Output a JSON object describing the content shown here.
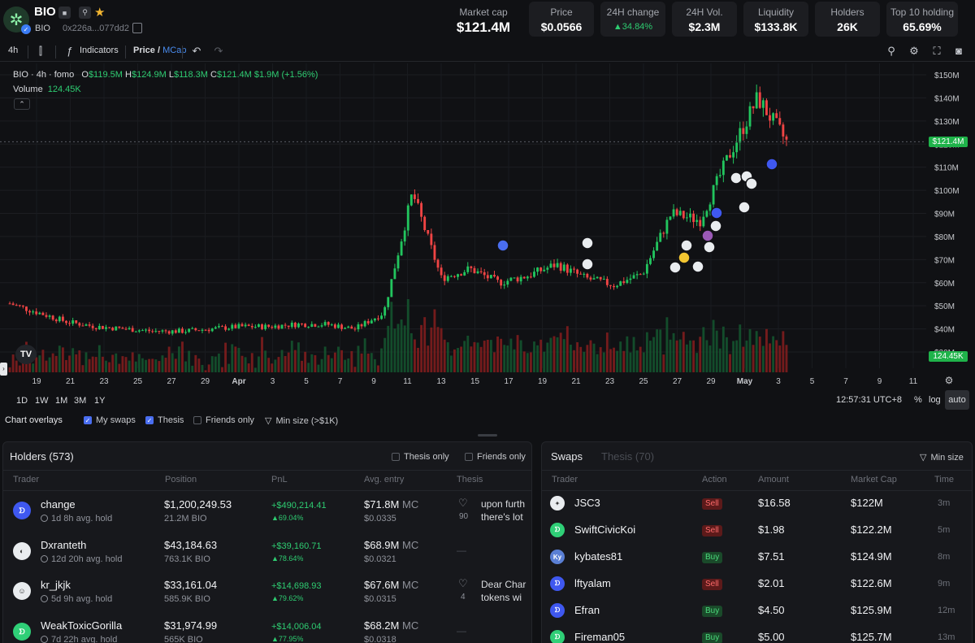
{
  "token": {
    "name": "BIO",
    "symbol": "BIO",
    "address": "0x226a...077dd2",
    "logo_icon": "sparkle-logo-icon"
  },
  "stats": {
    "market_cap": {
      "label": "Market cap",
      "value": "$121.4M"
    },
    "price": {
      "label": "Price",
      "value": "$0.0566"
    },
    "change": {
      "label": "24H change",
      "value": "▲34.84%"
    },
    "volume": {
      "label": "24H Vol.",
      "value": "$2.3M"
    },
    "liquidity": {
      "label": "Liquidity",
      "value": "$133.8K"
    },
    "holders": {
      "label": "Holders",
      "value": "26K"
    },
    "top10": {
      "label": "Top 10 holding",
      "value": "65.69%"
    }
  },
  "toolbar": {
    "interval": "4h",
    "indicators": "Indicators",
    "price_label": "Price",
    "mcap_label": "MCap"
  },
  "chart_legend": {
    "title": "BIO · 4h · fomo",
    "o_key": "O",
    "o": "$119.5M",
    "h_key": "H",
    "h": "$124.9M",
    "l_key": "L",
    "l": "$118.3M",
    "c_key": "C",
    "c": "$121.4M",
    "change": "$1.9M (+1.56%)",
    "volume_label": "Volume",
    "volume_value": "124.45K"
  },
  "chart_data": {
    "type": "line",
    "title": "",
    "y_ticks": [
      "$150M",
      "$140M",
      "$130M",
      "$120M",
      "$110M",
      "$100M",
      "$90M",
      "$80M",
      "$70M",
      "$60M",
      "$50M",
      "$40M",
      "$30M"
    ],
    "x_ticks": [
      "19",
      "21",
      "23",
      "25",
      "27",
      "29",
      "Apr",
      "3",
      "5",
      "7",
      "9",
      "11",
      "13",
      "15",
      "17",
      "19",
      "21",
      "23",
      "25",
      "27",
      "29",
      "May",
      "3",
      "5",
      "7",
      "9",
      "11"
    ],
    "x_labels_dates": [
      "Mar 19",
      "Mar 21",
      "Mar 23",
      "Mar 25",
      "Mar 27",
      "Mar 29",
      "Apr 1",
      "Apr 3",
      "Apr 5",
      "Apr 7",
      "Apr 9",
      "Apr 11",
      "Apr 13",
      "Apr 15",
      "Apr 17",
      "Apr 19",
      "Apr 21",
      "Apr 23",
      "Apr 25",
      "Apr 27",
      "Apr 29",
      "May 1",
      "May 3"
    ],
    "market_cap_musd": [
      51,
      47,
      43,
      41,
      40,
      39,
      39,
      40,
      41,
      41,
      42,
      42,
      40,
      47,
      99,
      62,
      66,
      60,
      63,
      68,
      62,
      59,
      64,
      90,
      87,
      115,
      140,
      121
    ],
    "current_label": "$121.4M",
    "volume_label": "124.45K",
    "ylim": [
      30,
      150
    ],
    "grid": true
  },
  "timeframes": [
    "1D",
    "1W",
    "1M",
    "3M",
    "1Y"
  ],
  "chart_footer": {
    "clock": "12:57:31 UTC+8",
    "percent": "%",
    "log": "log",
    "auto": "auto"
  },
  "overlays": {
    "title": "Chart overlays",
    "my_swaps": "My swaps",
    "thesis": "Thesis",
    "friends_only": "Friends only",
    "min_size": "Min size (>$1K)"
  },
  "holders": {
    "title": "Holders (573)",
    "thesis_only": "Thesis only",
    "friends_only": "Friends only",
    "columns": [
      "Trader",
      "Position",
      "PnL",
      "Avg. entry",
      "Thesis"
    ],
    "rows": [
      {
        "name": "change",
        "hold": "1d 8h avg. hold",
        "position": "$1,200,249.53",
        "amount": "21.2M BIO",
        "pnl": "+$490,214.41",
        "pnl_pct": "▲69.04%",
        "mc": "$71.8M",
        "mc_unit": "MC",
        "entry": "$0.0335",
        "thesis": "upon furth",
        "thesis2": "there's lot",
        "likes": "90"
      },
      {
        "name": "Dxranteth",
        "hold": "12d 20h avg. hold",
        "position": "$43,184.63",
        "amount": "763.1K BIO",
        "pnl": "+$39,160.71",
        "pnl_pct": "▲78.64%",
        "mc": "$68.9M",
        "mc_unit": "MC",
        "entry": "$0.0321",
        "thesis": "—"
      },
      {
        "name": "kr_jkjk",
        "hold": "5d 9h avg. hold",
        "position": "$33,161.04",
        "amount": "585.9K BIO",
        "pnl": "+$14,698.93",
        "pnl_pct": "▲79.62%",
        "mc": "$67.6M",
        "mc_unit": "MC",
        "entry": "$0.0315",
        "thesis": "Dear Char",
        "thesis2": "tokens wi",
        "likes": "4"
      },
      {
        "name": "WeakToxicGorilla",
        "hold": "7d 22h avg. hold",
        "position": "$31,974.99",
        "amount": "565K BIO",
        "pnl": "+$14,006.04",
        "pnl_pct": "▲77.95%",
        "mc": "$68.2M",
        "mc_unit": "MC",
        "entry": "$0.0318",
        "thesis": "—"
      }
    ]
  },
  "swaps": {
    "tab_swaps": "Swaps",
    "tab_thesis": "Thesis (70)",
    "min_size": "Min size",
    "columns": [
      "Trader",
      "Action",
      "Amount",
      "Market Cap",
      "Time"
    ],
    "rows": [
      {
        "name": "JSC3",
        "action": "Sell",
        "amount": "$16.58",
        "mc": "$122M",
        "time": "3m"
      },
      {
        "name": "SwiftCivicKoi",
        "action": "Sell",
        "amount": "$1.98",
        "mc": "$122.2M",
        "time": "5m"
      },
      {
        "name": "kybates81",
        "action": "Buy",
        "amount": "$7.51",
        "mc": "$124.9M",
        "time": "8m"
      },
      {
        "name": "lftyalam",
        "action": "Sell",
        "amount": "$2.01",
        "mc": "$122.6M",
        "time": "9m"
      },
      {
        "name": "Efran",
        "action": "Buy",
        "amount": "$4.50",
        "mc": "$125.9M",
        "time": "12m"
      },
      {
        "name": "Fireman05",
        "action": "Buy",
        "amount": "$5.00",
        "mc": "$125.7M",
        "time": "13m"
      }
    ]
  },
  "colors": {
    "up": "#22c55e",
    "down": "#ef4444",
    "accent": "#4a6ef0",
    "bg": "#101114"
  }
}
